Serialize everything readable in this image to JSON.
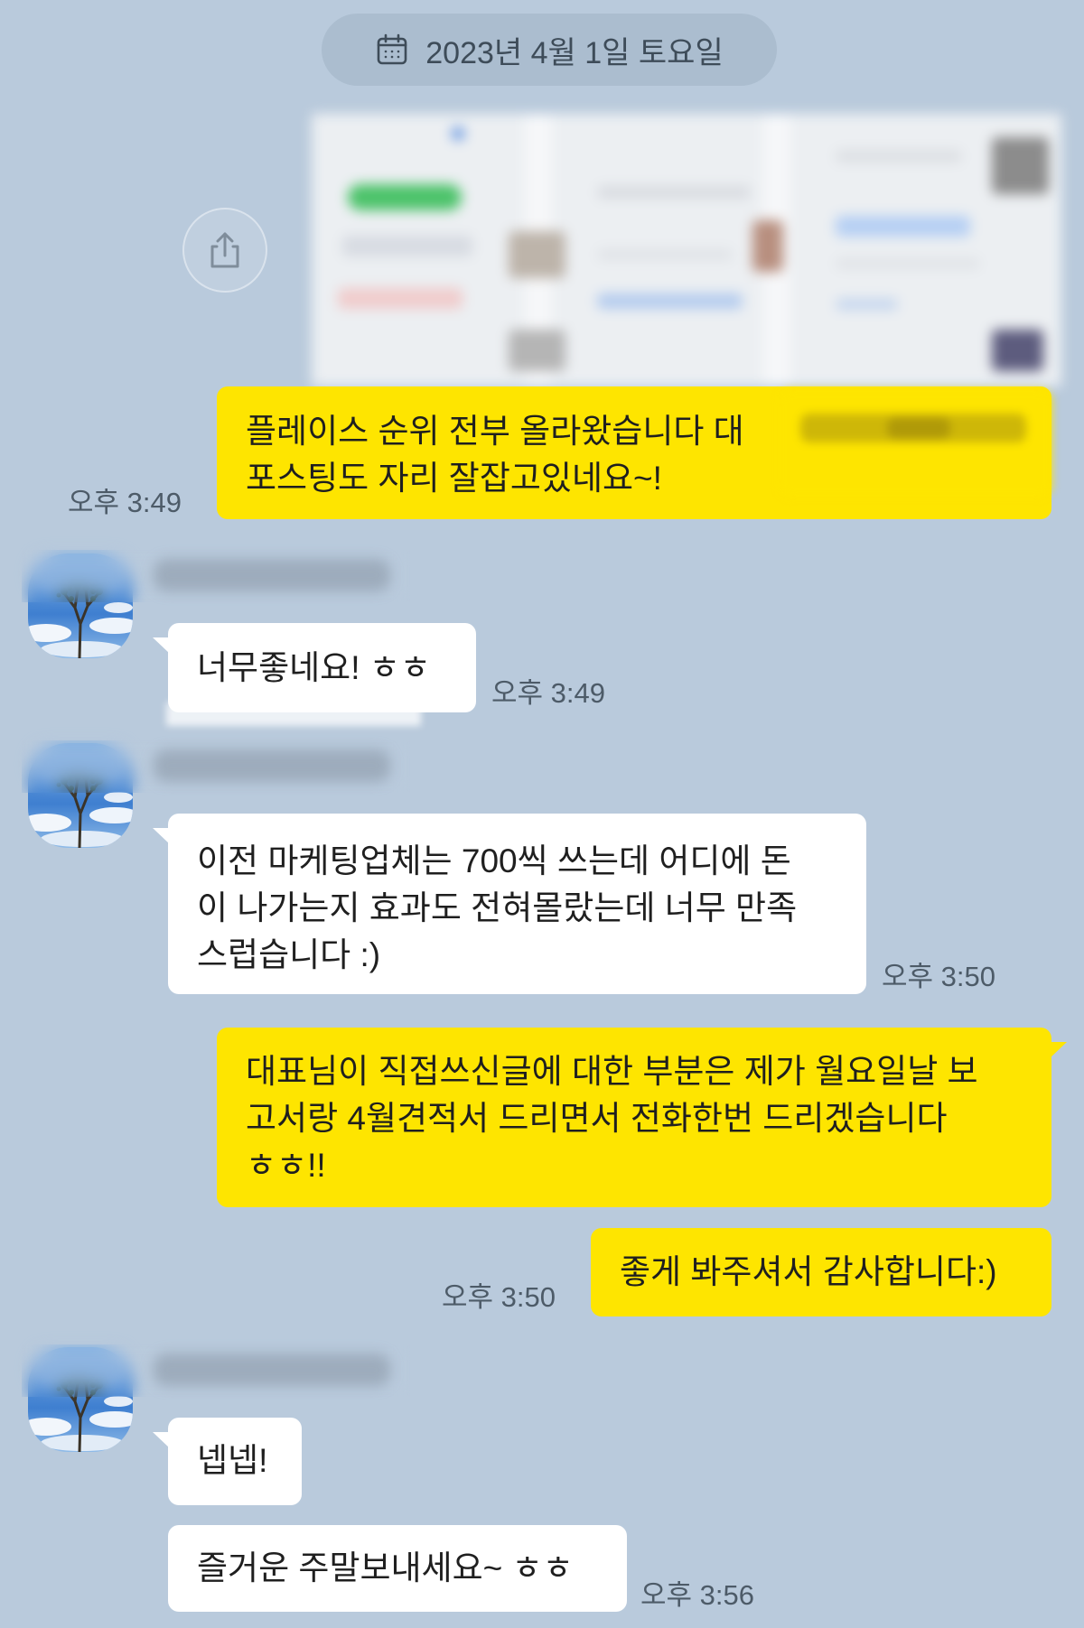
{
  "theme": {
    "background": "#b9cadc",
    "sent_bubble": "#fee500",
    "received_bubble": "#ffffff",
    "time_text": "#4d5b68",
    "date_pill": "#abbdcf"
  },
  "date_divider": {
    "icon": "calendar-icon",
    "label": "2023년 4월 1일 토요일"
  },
  "shared_image": {
    "action_icon": "share-icon"
  },
  "messages": [
    {
      "outgoing": true,
      "lines": [
        "플레이스 순위 전부 올라왔습니다 대",
        "포스팅도 자리 잘잡고있네요~!"
      ],
      "time": "오후 3:49"
    },
    {
      "outgoing": false,
      "lines": [
        "너무좋네요! ㅎㅎ"
      ],
      "time": "오후 3:49"
    },
    {
      "outgoing": false,
      "lines": [
        "이전 마케팅업체는 700씩 쓰는데 어디에 돈",
        "이 나가는지 효과도 전혀몰랐는데 너무 만족",
        "스럽습니다 :)"
      ],
      "time": "오후 3:50"
    },
    {
      "outgoing": true,
      "lines": [
        "대표님이 직접쓰신글에 대한 부분은 제가 월요일날 보",
        "고서랑 4월견적서 드리면서 전화한번 드리겠습니다",
        "ㅎㅎ!!"
      ]
    },
    {
      "outgoing": true,
      "lines": [
        "좋게 봐주셔서 감사합니다:)"
      ],
      "time": "오후 3:50"
    },
    {
      "outgoing": false,
      "lines": [
        "넵넵!"
      ]
    },
    {
      "outgoing": false,
      "lines": [
        "즐거운 주말보내세요~ ㅎㅎ"
      ],
      "time": "오후 3:56"
    }
  ]
}
